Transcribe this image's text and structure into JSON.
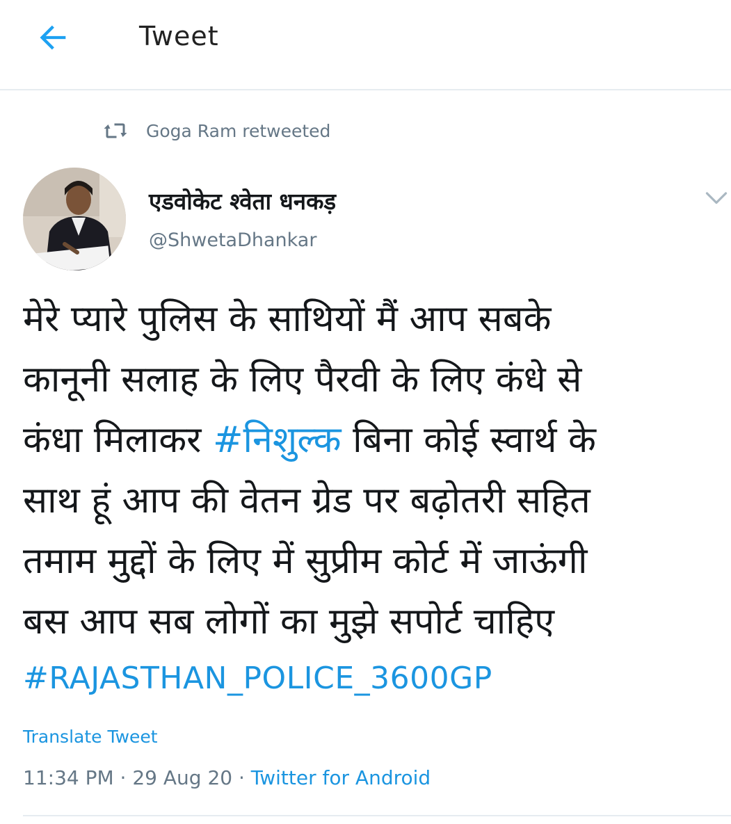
{
  "header": {
    "title": "Tweet",
    "back_icon": "arrow-left-icon",
    "accent_color": "#1da1f2"
  },
  "retweet": {
    "icon": "retweet-icon",
    "text": "Goga Ram retweeted"
  },
  "author": {
    "display_name": "एडवोकेट श्वेता धनकड़",
    "handle": "@ShwetaDhankar",
    "avatar_icon": "profile-photo"
  },
  "tweet": {
    "lines": [
      {
        "before": "मेरे प्यारे पुलिस के साथियों मैं आप सबके"
      },
      {
        "before": "कानूनी सलाह के लिए पैरवी के  लिए कंधे से"
      },
      {
        "before": "कंधा मिलाकर ",
        "hashtag": "#निशुल्क",
        "after": " बिना कोई स्वार्थ के"
      },
      {
        "before": "साथ हूं आप की वेतन ग्रेड पर बढ़ोतरी सहित"
      },
      {
        "before": "तमाम मुद्दों के लिए में सुप्रीम कोर्ट में जाऊंगी"
      },
      {
        "before": "बस आप सब लोगों का मुझे सपोर्ट चाहिए"
      }
    ],
    "hashtag_line": "#RAJASTHAN_POLICE_3600GP",
    "translate_label": "Translate Tweet",
    "time": "11:34 PM",
    "separator": " · ",
    "date": "29 Aug 20",
    "source": "Twitter for Android",
    "link_color": "#1b95e0"
  },
  "chevron_icon": "chevron-down-icon"
}
